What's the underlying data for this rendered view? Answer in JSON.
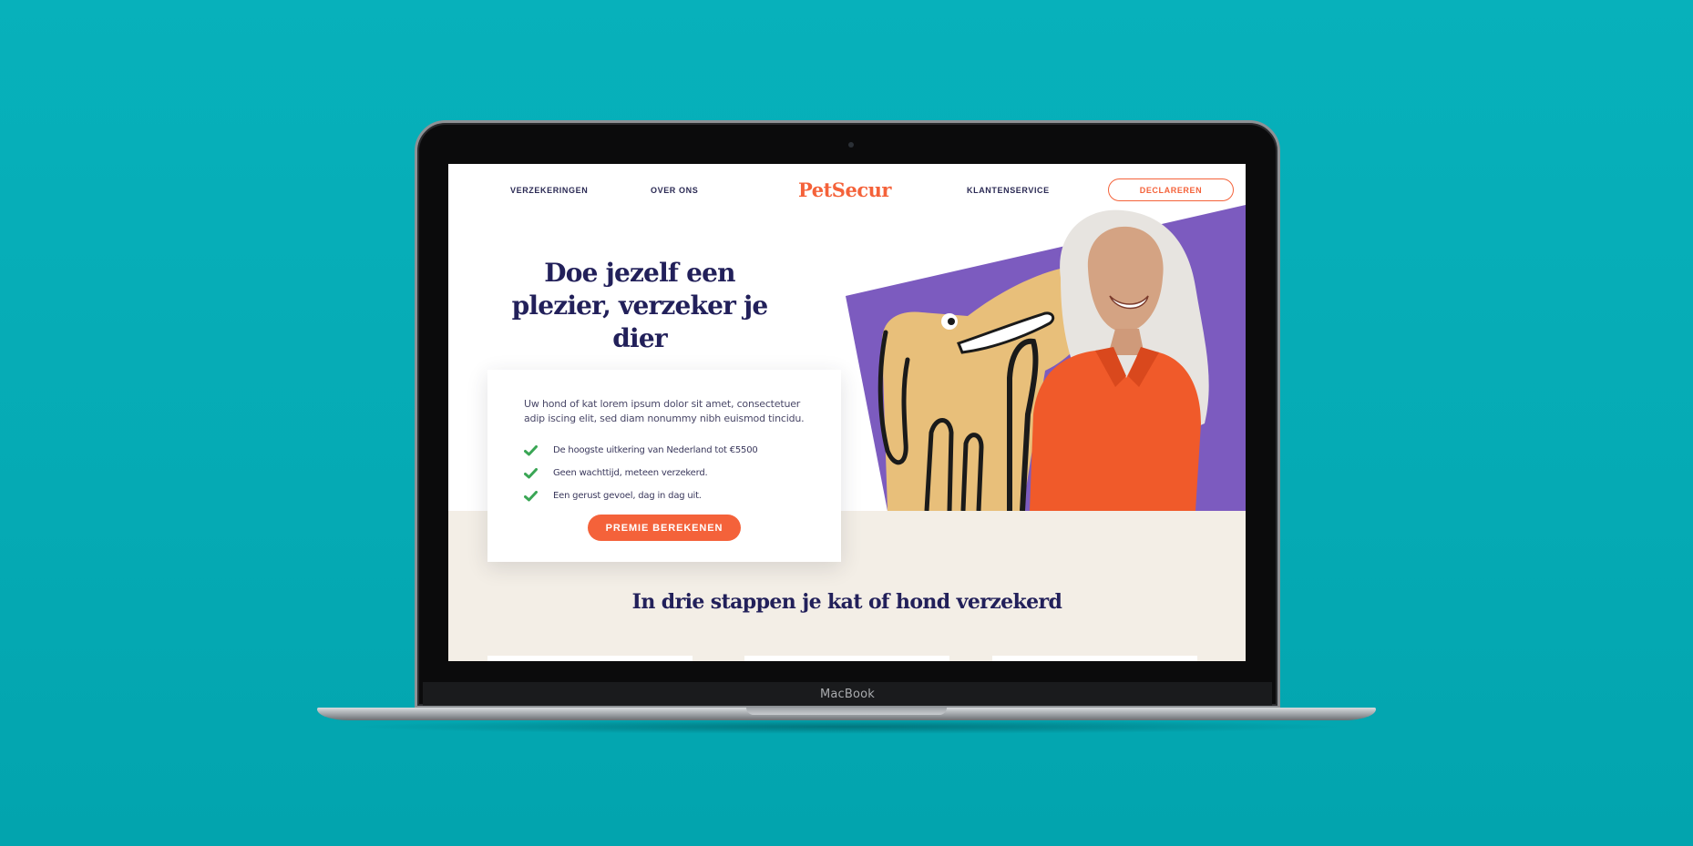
{
  "device": {
    "brand_label": "MacBook"
  },
  "nav": {
    "items": [
      {
        "label": "VERZEKERINGEN"
      },
      {
        "label": "OVER ONS"
      },
      {
        "label": "KLANTENSERVICE"
      }
    ],
    "logo": "PetSecur",
    "cta_label": "DECLAREREN"
  },
  "hero": {
    "title": "Doe jezelf een plezier, verzeker je dier"
  },
  "card": {
    "intro": "Uw hond of kat lorem ipsum dolor sit amet, consectetuer adip iscing elit, sed diam nonummy nibh euismod tincidu.",
    "benefits": [
      {
        "label": "De hoogste uitkering van Nederland tot €5500"
      },
      {
        "label": "Geen wachttijd, meteen verzekerd."
      },
      {
        "label": "Een gerust gevoel, dag in dag uit."
      }
    ],
    "button_label": "PREMIE BEREKENEN"
  },
  "steps": {
    "title": "In drie stappen je kat of hond verzekerd"
  },
  "colors": {
    "background": "#05aab4",
    "brand": "#f4623a",
    "navy": "#22205a",
    "purple": "#7c5bbf",
    "dog": "#e8bf7a",
    "band": "#f3eee6",
    "check": "#3aa655"
  },
  "icons": {
    "check": "check-icon",
    "webcam": "webcam-icon"
  }
}
